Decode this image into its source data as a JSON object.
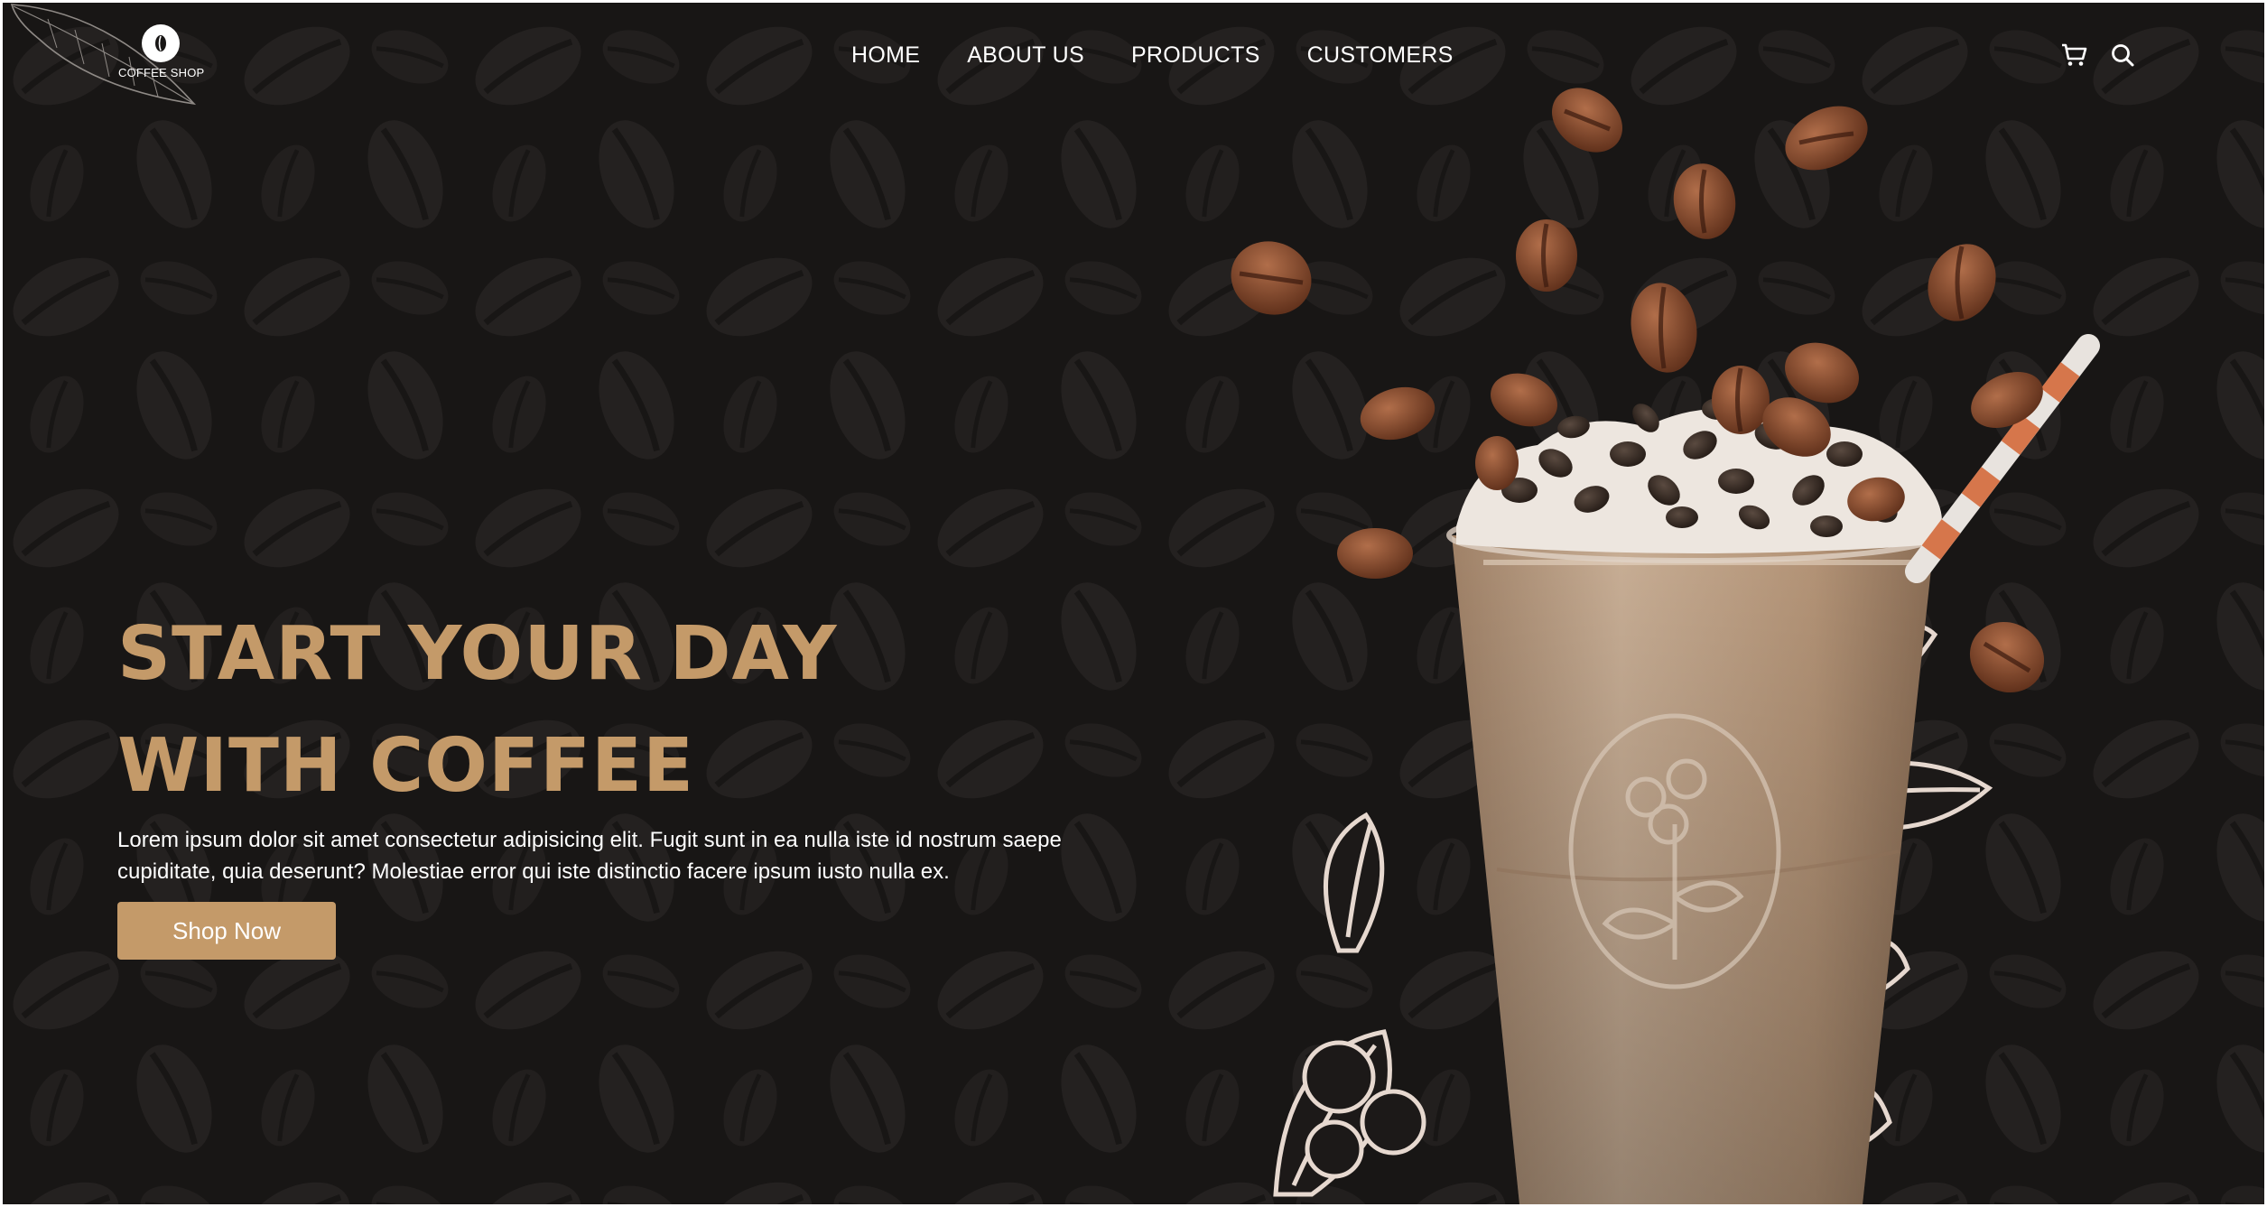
{
  "brand": {
    "name": "COFFEE SHOP",
    "icon": "coffee-bean-icon"
  },
  "nav": {
    "items": [
      "HOME",
      "ABOUT US",
      "PRODUCTS",
      "CUSTOMERS"
    ]
  },
  "header_icons": {
    "cart": "cart-icon",
    "search": "search-icon"
  },
  "hero": {
    "headline_line1": "START YOUR DAY",
    "headline_line2": "WITH COFFEE",
    "description": "Lorem ipsum dolor sit amet consectetur adipisicing elit. Fugit sunt in ea nulla iste id nostrum saepe cupiditate, quia deserunt? Molestiae error qui iste distinctio facere ipsum iusto nulla ex.",
    "cta_label": "Shop Now"
  },
  "colors": {
    "background": "#181615",
    "pattern_bean": "#242120",
    "accent": "#c49a69",
    "text": "#ffffff"
  }
}
